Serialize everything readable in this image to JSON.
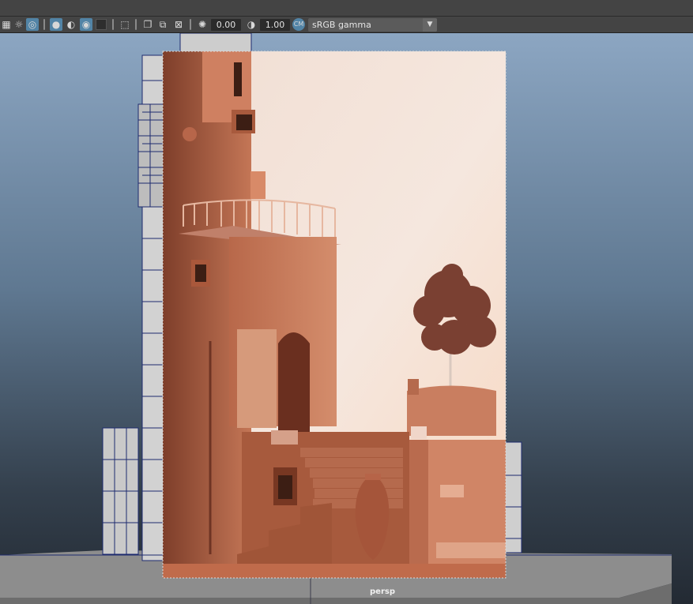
{
  "toolbar": {
    "icons": [
      "checker-icon",
      "light-icon",
      "lasso-icon",
      "shaded-sphere-icon",
      "smooth-sphere-icon",
      "target-icon",
      "dark-swatch-icon",
      "select-arrow-icon",
      "copy-icon",
      "overlap-icon",
      "resize-icon",
      "aperture-icon",
      "half-circle-icon",
      "color-manage-icon"
    ],
    "exposure_value": "0.00",
    "gamma_value": "1.00",
    "color_space": "sRGB gamma"
  },
  "viewport": {
    "camera_label": "persp"
  },
  "colors": {
    "accent": "#5284a6",
    "toolbar_bg": "#444444",
    "wire": "#1d2a6e",
    "terracotta": "#c06b4b"
  }
}
